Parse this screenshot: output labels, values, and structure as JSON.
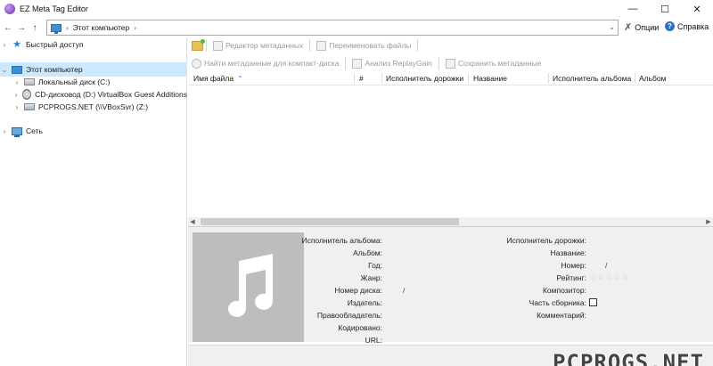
{
  "window": {
    "title": "EZ Meta Tag Editor",
    "minimize": "—",
    "maximize": "☐",
    "close": "✕"
  },
  "address": {
    "path": "Этот компьютер",
    "separator": "›",
    "end_separator": "›",
    "dropdown": "⌄"
  },
  "tools": {
    "options": "Опции",
    "help": "Справка"
  },
  "tree": {
    "quick_access": "Быстрый доступ",
    "this_pc": "Этот компьютер",
    "drives": [
      {
        "label": "Локальный диск (C:)",
        "icon": "drive-icon"
      },
      {
        "label": "CD-дисковод (D:) VirtualBox Guest Additions",
        "icon": "cd-icon"
      },
      {
        "label": "PCPROGS.NET (\\\\VBoxSvr) (Z:)",
        "icon": "network-drive-icon"
      }
    ],
    "network": "Сеть"
  },
  "toolbar1": {
    "metadata_editor": "Редактор метаданных",
    "rename_files": "Переименовать файлы"
  },
  "toolbar2": {
    "find_cd": "Найти метаданные для компакт-диска",
    "replaygain": "Анализ ReplayGain",
    "save": "Сохранить метаданные"
  },
  "columns": {
    "filename": "Имя файла",
    "number": "#",
    "track_artist": "Исполнитель дорожки",
    "title": "Название",
    "album_artist": "Исполнитель альбома",
    "album": "Альбом"
  },
  "details_left": {
    "album_artist": "Исполнитель альбома:",
    "album": "Альбом:",
    "year": "Год:",
    "genre": "Жанр:",
    "disc_number": "Номер диска:",
    "disc_number_value": "/",
    "publisher": "Издатель:",
    "copyright": "Правообладатель:",
    "encoded_by": "Кодировано:",
    "url": "URL:"
  },
  "details_right": {
    "track_artist": "Исполнитель дорожки:",
    "title": "Название:",
    "number": "Номер:",
    "number_value": "/",
    "rating": "Рейтинг:",
    "rating_stars": "☆☆☆☆☆",
    "composer": "Композитор:",
    "compilation": "Часть сборника:",
    "comment": "Комментарий:"
  },
  "watermark": "PCPROGS.NET",
  "colors": {
    "selection": "#cce8ff",
    "accent": "#7a4fc7",
    "pc_blue": "#3d8fd8"
  }
}
